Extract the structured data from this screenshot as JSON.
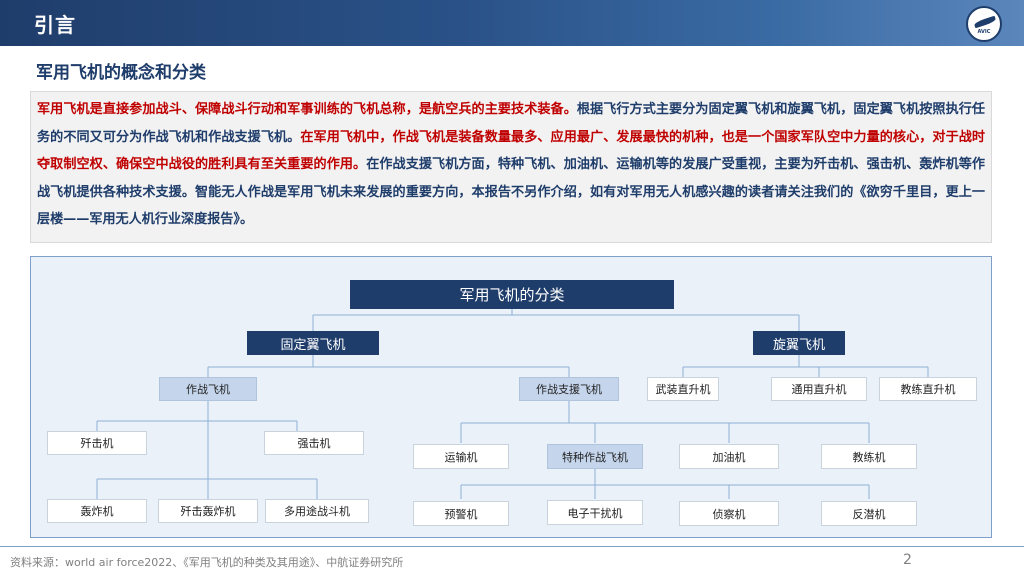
{
  "header": {
    "title": "引言",
    "logo_text": "AVIC"
  },
  "subtitle": "军用飞机的概念和分类",
  "intro": {
    "red_part": "军用飞机是直接参加战斗、保障战斗行动和军事训练的飞机总称，是航空兵的主要技术装备。",
    "blue_part_1": "根据飞行方式主要分为固定翼飞机和旋翼飞机，固定翼飞机按照执行任务的不同又可分为作战飞机和作战支援飞机。",
    "red_part_2": "在军用飞机中，作战飞机是装备数量最多、应用最广、发展最快的机种，也是一个国家军队空中力量的核心，对于战时夺取制空权、确保空中战役的胜利具有至关重要的作用。",
    "blue_part_2": "在作战支援飞机方面，特种飞机、加油机、运输机等的发展广受重视，主要为歼击机、强击机、轰炸机等作战飞机提供各种技术支援。智能无人作战是军用飞机未来发展的重要方向，本报告不另作介绍，如有对军用无人机感兴趣的读者请关注我们的《欲穷千里目，更上一层楼——军用无人机行业深度报告》。"
  },
  "diagram": {
    "root": "军用飞机的分类",
    "fixed_wing": "固定翼飞机",
    "rotary_wing": "旋翼飞机",
    "combat": "作战飞机",
    "support": "作战支援飞机",
    "fighter": "歼击机",
    "attacker": "强击机",
    "bomber": "轰炸机",
    "fighter_bomber": "歼击轰炸机",
    "multirole": "多用途战斗机",
    "transport": "运输机",
    "special": "特种作战飞机",
    "tanker": "加油机",
    "trainer": "教练机",
    "aew": "预警机",
    "ew": "电子干扰机",
    "recon": "侦察机",
    "asw": "反潜机",
    "armed_heli": "武装直升机",
    "utility_heli": "通用直升机",
    "trainer_heli": "教练直升机"
  },
  "footer": {
    "source": "资料来源：world air force2022、《军用飞机的种类及其用途》、中航证券研究所",
    "page": "2"
  }
}
